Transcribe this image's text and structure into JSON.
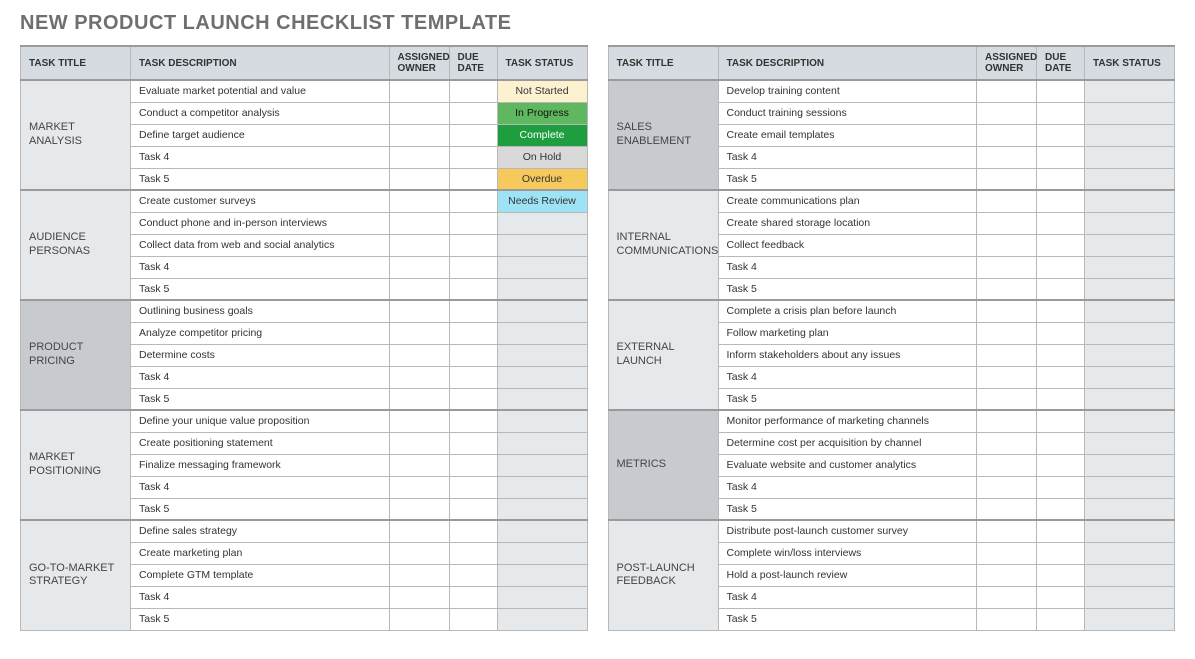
{
  "title": "NEW PRODUCT LAUNCH CHECKLIST TEMPLATE",
  "headers": {
    "task_title": "TASK TITLE",
    "task_description": "TASK DESCRIPTION",
    "assigned_owner": "ASSIGNED OWNER",
    "due_date": "DUE DATE",
    "task_status": "TASK STATUS"
  },
  "status_labels": {
    "not_started": "Not Started",
    "in_progress": "In Progress",
    "complete": "Complete",
    "on_hold": "On Hold",
    "overdue": "Overdue",
    "needs_review": "Needs Review"
  },
  "left_sections": [
    {
      "name": "MARKET ANALYSIS",
      "shade": "light",
      "rows": [
        {
          "desc": "Evaluate market potential and value",
          "owner": "",
          "due": "",
          "status": "not_started"
        },
        {
          "desc": "Conduct a competitor analysis",
          "owner": "",
          "due": "",
          "status": "in_progress"
        },
        {
          "desc": "Define target audience",
          "owner": "",
          "due": "",
          "status": "complete"
        },
        {
          "desc": "Task 4",
          "owner": "",
          "due": "",
          "status": "on_hold"
        },
        {
          "desc": "Task 5",
          "owner": "",
          "due": "",
          "status": "overdue"
        }
      ]
    },
    {
      "name": "AUDIENCE PERSONAS",
      "shade": "light",
      "rows": [
        {
          "desc": "Create customer surveys",
          "owner": "",
          "due": "",
          "status": "needs_review"
        },
        {
          "desc": "Conduct phone and in-person interviews",
          "owner": "",
          "due": "",
          "status": ""
        },
        {
          "desc": "Collect data from web and social analytics",
          "owner": "",
          "due": "",
          "status": ""
        },
        {
          "desc": "Task 4",
          "owner": "",
          "due": "",
          "status": ""
        },
        {
          "desc": "Task 5",
          "owner": "",
          "due": "",
          "status": ""
        }
      ]
    },
    {
      "name": "PRODUCT PRICING",
      "shade": "dark",
      "rows": [
        {
          "desc": "Outlining business goals",
          "owner": "",
          "due": "",
          "status": ""
        },
        {
          "desc": "Analyze competitor pricing",
          "owner": "",
          "due": "",
          "status": ""
        },
        {
          "desc": "Determine costs",
          "owner": "",
          "due": "",
          "status": ""
        },
        {
          "desc": "Task 4",
          "owner": "",
          "due": "",
          "status": ""
        },
        {
          "desc": "Task 5",
          "owner": "",
          "due": "",
          "status": ""
        }
      ]
    },
    {
      "name": "MARKET POSITIONING",
      "shade": "light",
      "rows": [
        {
          "desc": "Define your unique value proposition",
          "owner": "",
          "due": "",
          "status": ""
        },
        {
          "desc": "Create positioning statement",
          "owner": "",
          "due": "",
          "status": ""
        },
        {
          "desc": "Finalize messaging framework",
          "owner": "",
          "due": "",
          "status": ""
        },
        {
          "desc": "Task 4",
          "owner": "",
          "due": "",
          "status": ""
        },
        {
          "desc": "Task 5",
          "owner": "",
          "due": "",
          "status": ""
        }
      ]
    },
    {
      "name": "GO-TO-MARKET STRATEGY",
      "shade": "light",
      "rows": [
        {
          "desc": "Define sales strategy",
          "owner": "",
          "due": "",
          "status": ""
        },
        {
          "desc": "Create marketing plan",
          "owner": "",
          "due": "",
          "status": ""
        },
        {
          "desc": "Complete GTM template",
          "owner": "",
          "due": "",
          "status": ""
        },
        {
          "desc": "Task 4",
          "owner": "",
          "due": "",
          "status": ""
        },
        {
          "desc": "Task 5",
          "owner": "",
          "due": "",
          "status": ""
        }
      ]
    }
  ],
  "right_sections": [
    {
      "name": "SALES ENABLEMENT",
      "shade": "dark",
      "rows": [
        {
          "desc": "Develop training content",
          "owner": "",
          "due": "",
          "status": ""
        },
        {
          "desc": "Conduct training sessions",
          "owner": "",
          "due": "",
          "status": ""
        },
        {
          "desc": "Create email templates",
          "owner": "",
          "due": "",
          "status": ""
        },
        {
          "desc": "Task 4",
          "owner": "",
          "due": "",
          "status": ""
        },
        {
          "desc": "Task 5",
          "owner": "",
          "due": "",
          "status": ""
        }
      ]
    },
    {
      "name": "INTERNAL COMMUNICATIONS",
      "shade": "light",
      "rows": [
        {
          "desc": "Create communications plan",
          "owner": "",
          "due": "",
          "status": ""
        },
        {
          "desc": "Create shared storage location",
          "owner": "",
          "due": "",
          "status": ""
        },
        {
          "desc": "Collect feedback",
          "owner": "",
          "due": "",
          "status": ""
        },
        {
          "desc": "Task 4",
          "owner": "",
          "due": "",
          "status": ""
        },
        {
          "desc": "Task 5",
          "owner": "",
          "due": "",
          "status": ""
        }
      ]
    },
    {
      "name": "EXTERNAL LAUNCH",
      "shade": "light",
      "rows": [
        {
          "desc": "Complete a crisis plan before launch",
          "owner": "",
          "due": "",
          "status": ""
        },
        {
          "desc": "Follow marketing plan",
          "owner": "",
          "due": "",
          "status": ""
        },
        {
          "desc": "Inform stakeholders about any issues",
          "owner": "",
          "due": "",
          "status": ""
        },
        {
          "desc": "Task 4",
          "owner": "",
          "due": "",
          "status": ""
        },
        {
          "desc": "Task 5",
          "owner": "",
          "due": "",
          "status": ""
        }
      ]
    },
    {
      "name": "METRICS",
      "shade": "dark",
      "rows": [
        {
          "desc": "Monitor performance of marketing channels",
          "owner": "",
          "due": "",
          "status": ""
        },
        {
          "desc": "Determine cost per acquisition by channel",
          "owner": "",
          "due": "",
          "status": ""
        },
        {
          "desc": "Evaluate website and customer analytics",
          "owner": "",
          "due": "",
          "status": ""
        },
        {
          "desc": "Task 4",
          "owner": "",
          "due": "",
          "status": ""
        },
        {
          "desc": "Task 5",
          "owner": "",
          "due": "",
          "status": ""
        }
      ]
    },
    {
      "name": "POST-LAUNCH FEEDBACK",
      "shade": "light",
      "rows": [
        {
          "desc": "Distribute post-launch customer survey",
          "owner": "",
          "due": "",
          "status": ""
        },
        {
          "desc": "Complete win/loss interviews",
          "owner": "",
          "due": "",
          "status": ""
        },
        {
          "desc": "Hold a post-launch review",
          "owner": "",
          "due": "",
          "status": ""
        },
        {
          "desc": "Task 4",
          "owner": "",
          "due": "",
          "status": ""
        },
        {
          "desc": "Task 5",
          "owner": "",
          "due": "",
          "status": ""
        }
      ]
    }
  ]
}
